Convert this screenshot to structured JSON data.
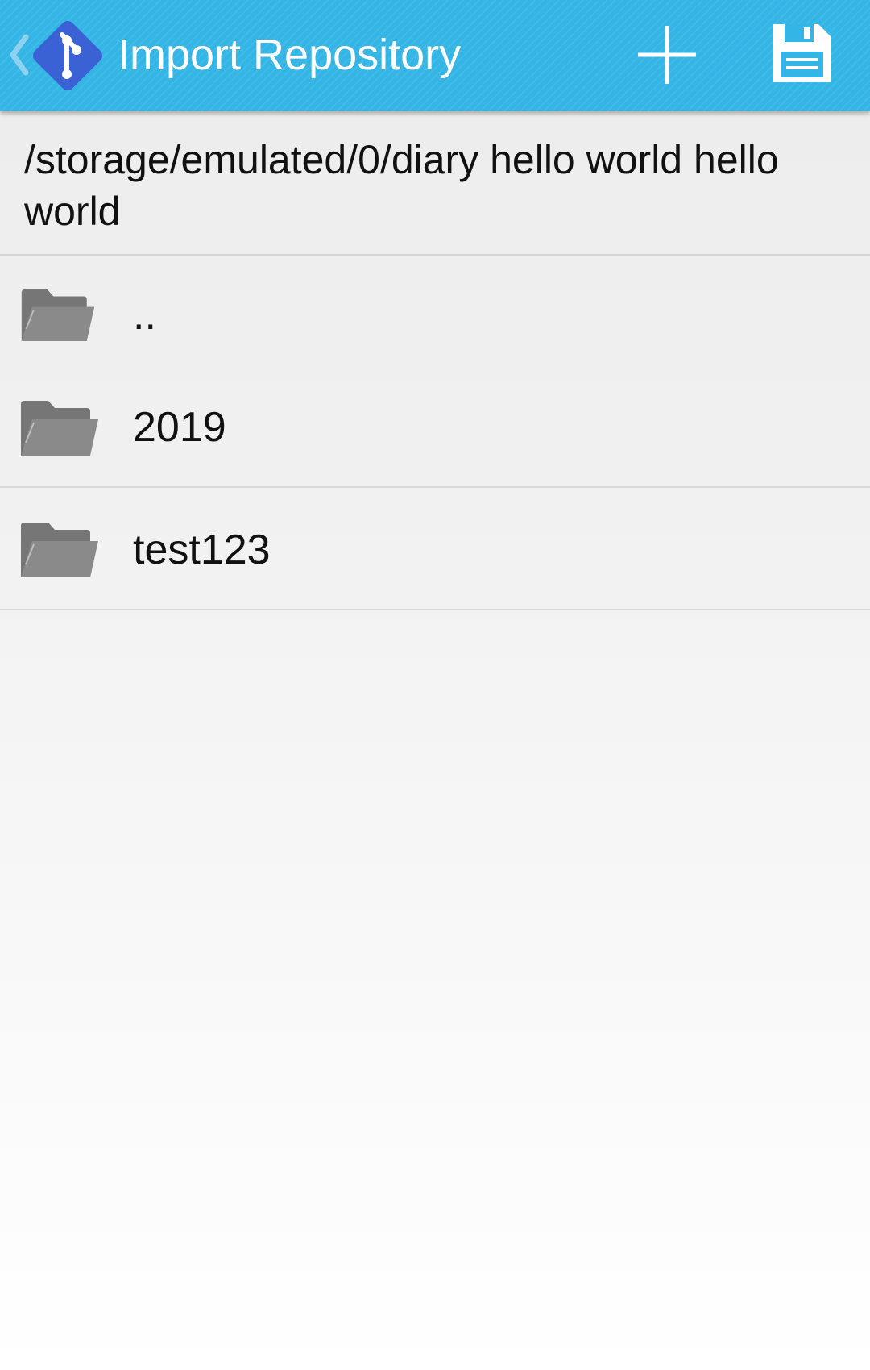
{
  "action_bar": {
    "title": "Import Repository",
    "up_icon": "chevron-left-icon",
    "logo_icon": "git-logo-icon",
    "actions": [
      {
        "name": "add",
        "icon": "plus-icon"
      },
      {
        "name": "save",
        "icon": "floppy-disk-icon"
      }
    ],
    "bar_color": "#33b5e5",
    "logo_color": "#3b62d5"
  },
  "path": {
    "current": "/storage/emulated/0/diary hello world hello world"
  },
  "folders": [
    {
      "label": "..",
      "icon": "folder-icon"
    },
    {
      "label": "2019",
      "icon": "folder-icon"
    },
    {
      "label": "test123",
      "icon": "folder-icon"
    }
  ]
}
